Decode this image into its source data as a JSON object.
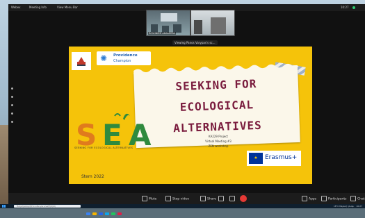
{
  "top_bar": {
    "left_items": [
      "Webex",
      "Meeting Info",
      "View Menu Bar"
    ],
    "time": "10:27"
  },
  "thumbnails": [
    {
      "caption": "ΕΛΛΗΝΙΚΗ ΑΚΑΔΗΜΙΑ"
    },
    {
      "caption": ""
    }
  ],
  "sharing_notice": "Viewing Panos Varypas's sc...",
  "slide": {
    "partner_logo_name": "Providence Champion",
    "providence": "Providence",
    "champion": "Champion",
    "title_lines": [
      "SEEKING FOR",
      "ECOLOGICAL",
      "ALTERNATIVES"
    ],
    "sea_letters": [
      "S",
      "E",
      "A"
    ],
    "sea_subtitle": "SEEKING FOR ECOLOGICAL ALTERNATIVES",
    "project_lines": [
      "KA229 Project",
      "Virtual Meeting #3",
      "ZEN workshop"
    ],
    "erasmus": "Erasmus+",
    "date": "Stem 2022"
  },
  "controls": {
    "mute": "Mute",
    "video": "Stop video",
    "share": "Share",
    "apps": "Apps",
    "participants": "Participants",
    "chat": "Chat"
  },
  "taskbar": {
    "search_placeholder": "Πληκτρολογήστε εδώ για αναζήτηση",
    "weather": "18°C Μερική ηλιοφ.",
    "clock": "10:27"
  },
  "colors": {
    "slide_bg": "#f5c30a",
    "title": "#7a1c3e",
    "end_call": "#e53935",
    "eu_blue": "#003399"
  }
}
